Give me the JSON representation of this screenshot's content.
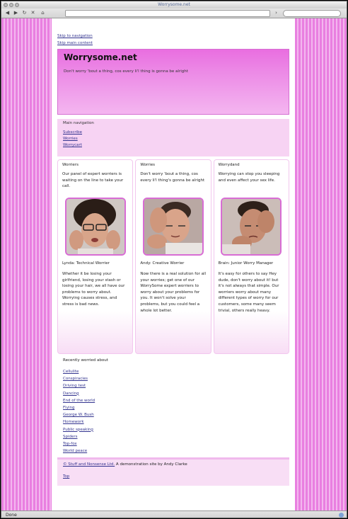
{
  "browser": {
    "title": "Worrysome.net",
    "url": "",
    "search": "",
    "status": "Done"
  },
  "skip": {
    "navigation": "Skip to navigation",
    "content": "Skip main content"
  },
  "header": {
    "title": "Worrysome.net",
    "tagline": "Don't worry 'bout a thing, cos every li'l thing is gonna be alright"
  },
  "nav": {
    "heading": "Main navigation",
    "items": [
      "Subscribe",
      "Worries",
      "Worrycart"
    ]
  },
  "columns": [
    {
      "title": "Worriers",
      "text": "Our panel of expert worriers is waiting on the line to take your call.",
      "caption": "Lynda: Technical Worrier",
      "body": "Whether it be losing your girlfriend, losing your stash or losing your hair, we all have our problems to worry about. Worrying causes stress, and stress is bad news."
    },
    {
      "title": "Worries",
      "text": "Don't worry 'bout a thing, cos every li'l thing's gonna be alright",
      "caption": "Andy: Creative Worrier",
      "body": "Now there is a real solution for all your worries; get one of our WorrySome expert worriers to worry about your problems for you. It won't solve your problems, but you could feel a whole lot better."
    },
    {
      "title": "Worrydand",
      "text": "Worrying can stop you sleeping and even affect your sex life.",
      "caption": "Brain: Junior Worry Manager",
      "body": "It's easy for others to say Hey dude, don't worry about it! but it's not always that simple. Our worriers worry about many different types of worry for our customers, some many seem trivial, others really heavy."
    }
  ],
  "recent": {
    "heading": "Recently worried about",
    "items": [
      "Cellulite",
      "Conspiracies",
      "Driving test",
      "Dancing",
      "End of the world",
      "Flying",
      "George W. Bush",
      "Homework",
      "Public speaking",
      "Spiders",
      "Top-fox",
      "World peace"
    ]
  },
  "footer": {
    "copyright_link": "© Stuff and Nonsense Ltd.",
    "copyright_rest": " A demonstration site by Andy Clarke",
    "top": "Top"
  },
  "colors": {
    "accent": "#e96ee0",
    "link": "#33348f",
    "nav_bg": "#f7d3f3"
  }
}
